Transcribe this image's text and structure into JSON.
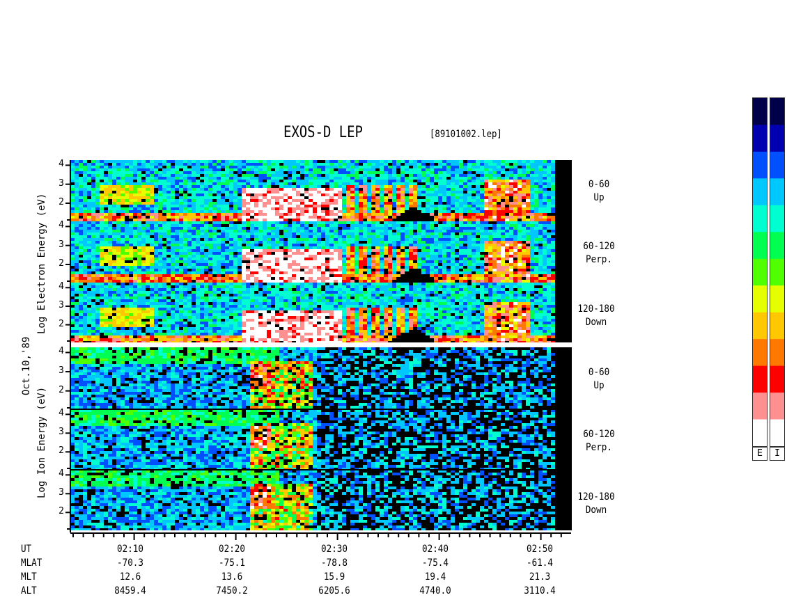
{
  "chart_data": {
    "type": "heatmap",
    "title": "EXOS-D LEP",
    "file_label": "[89101002.lep]",
    "date_label": "Oct.10,'89",
    "electron_ylabel": "Log   Electron   Energy (eV)",
    "ion_ylabel": "Log   Ion   Energy (eV)",
    "energy_ticks": [
      "4",
      "3",
      "2"
    ],
    "panels": [
      {
        "species": "Electron",
        "pitch_range": "0-60",
        "direction": "Up"
      },
      {
        "species": "Electron",
        "pitch_range": "60-120",
        "direction": "Perp."
      },
      {
        "species": "Electron",
        "pitch_range": "120-180",
        "direction": "Down"
      },
      {
        "species": "Ion",
        "pitch_range": "0-60",
        "direction": "Up"
      },
      {
        "species": "Ion",
        "pitch_range": "60-120",
        "direction": "Perp."
      },
      {
        "species": "Ion",
        "pitch_range": "120-180",
        "direction": "Down"
      }
    ],
    "colorbar_labels": [
      "E",
      "I"
    ],
    "colorscale": [
      "#00004a",
      "#0000b0",
      "#0050ff",
      "#00c8ff",
      "#00ffd0",
      "#00ff50",
      "#50ff00",
      "#e6ff00",
      "#ffc800",
      "#ff7800",
      "#ff0000",
      "#ff9090",
      "#ffffff"
    ],
    "ephemeris": {
      "row_labels": [
        "UT",
        "MLAT",
        "MLT",
        "ALT"
      ],
      "UT": [
        "02:10",
        "02:20",
        "02:30",
        "02:40",
        "02:50"
      ],
      "MLAT": [
        "-70.3",
        "-75.1",
        "-78.8",
        "-75.4",
        "-61.4"
      ],
      "MLT": [
        "12.6",
        "13.6",
        "15.9",
        "19.4",
        "21.3"
      ],
      "ALT": [
        "8459.4",
        "7450.2",
        "6205.6",
        "4740.0",
        "3110.4"
      ]
    }
  }
}
